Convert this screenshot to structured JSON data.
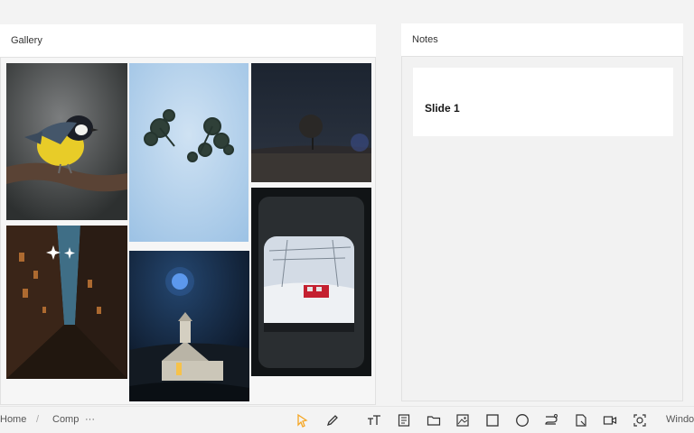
{
  "gallery": {
    "title": "Gallery"
  },
  "notes": {
    "title": "Notes",
    "slide_title": "Slide 1"
  },
  "breadcrumb": {
    "home": "Home",
    "separator": "/",
    "current": "Comp",
    "more": "···"
  },
  "toolbar": {
    "window_label": "Window"
  },
  "colors": {
    "accent_orange": "#f5a623"
  }
}
